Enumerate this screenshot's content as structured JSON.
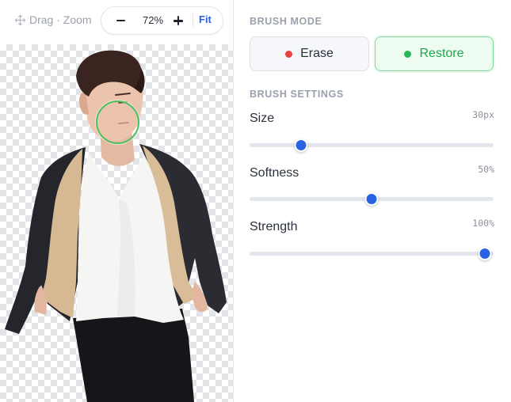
{
  "toolbar": {
    "hint_icon": "move-icon",
    "hint_label": "Drag · Zoom",
    "zoom_value": "72%",
    "fit_label": "Fit",
    "zoom_level": 0.72
  },
  "canvas": {
    "checker_color": "#e3e4e8",
    "brush_cursor_color": "#4cc05f"
  },
  "brush_mode": {
    "title": "BRUSH MODE",
    "erase": {
      "label": "Erase",
      "dot_color": "#ec4040",
      "selected": false
    },
    "restore": {
      "label": "Restore",
      "dot_color": "#27b957",
      "selected": true
    }
  },
  "brush_settings": {
    "title": "BRUSH SETTINGS",
    "accent_color": "#2a63e2",
    "items": [
      {
        "label": "Size",
        "value": "30px",
        "fraction": 0.21
      },
      {
        "label": "Softness",
        "value": "50%",
        "fraction": 0.5
      },
      {
        "label": "Strength",
        "value": "100%",
        "fraction": 0.965
      }
    ]
  }
}
